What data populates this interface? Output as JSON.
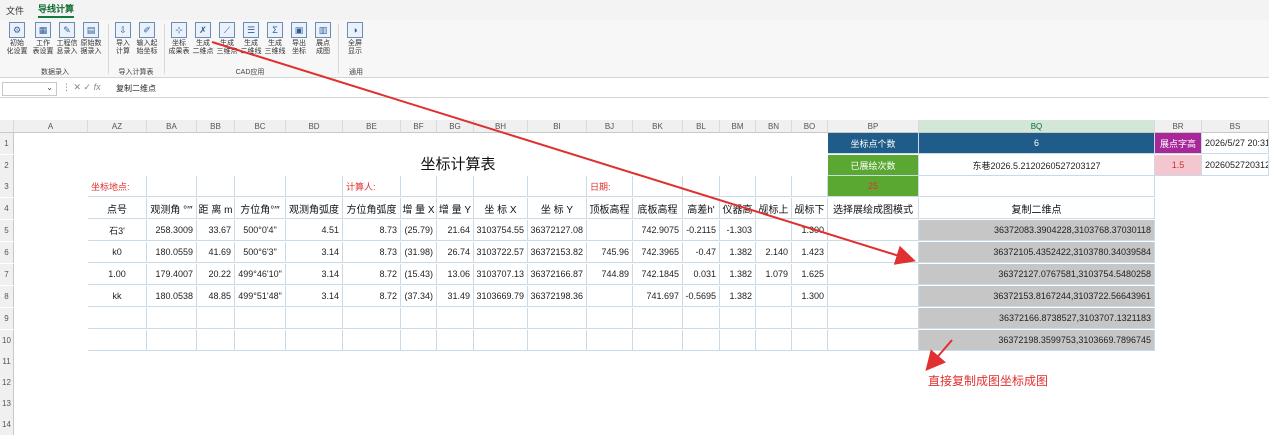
{
  "ribbon": {
    "tabs": [
      "文件",
      "导线计算"
    ],
    "active_tab": "导线计算",
    "buttons": [
      {
        "label": "初始化设置",
        "l1": "初始",
        "l2": "化设置",
        "icon": "settings-icon"
      },
      {
        "label": "工作表设置",
        "l1": "工作",
        "l2": "表设置",
        "icon": "table-icon"
      },
      {
        "label": "工程信息录入",
        "l1": "工程信",
        "l2": "息录入",
        "icon": "edit-icon"
      },
      {
        "label": "原始数据录入",
        "l1": "原始数",
        "l2": "据录入",
        "icon": "data-icon"
      },
      {
        "label": "导入计算",
        "l1": "导入",
        "l2": "计算",
        "icon": "import-icon"
      },
      {
        "label": "输入起始坐标",
        "l1": "输入起",
        "l2": "始坐标",
        "icon": "pen-icon"
      },
      {
        "label": "坐标成果表",
        "l1": "坐标",
        "l2": "成果表",
        "icon": "coord-icon"
      },
      {
        "label": "生成二维点",
        "l1": "生成",
        "l2": "二维点",
        "icon": "point2d-icon"
      },
      {
        "label": "生成三维点",
        "l1": "生成",
        "l2": "三维点",
        "icon": "point3d-icon"
      },
      {
        "label": "生成二维线",
        "l1": "生成",
        "l2": "二维线",
        "icon": "line2d-icon"
      },
      {
        "label": "生成三维线",
        "l1": "生成",
        "l2": "三维线",
        "icon": "sigma-icon"
      },
      {
        "label": "导出坐标",
        "l1": "导出",
        "l2": "坐标",
        "icon": "export-icon"
      },
      {
        "label": "展点成图",
        "l1": "展点",
        "l2": "成图",
        "icon": "plot-icon"
      },
      {
        "label": "全屏显示",
        "l1": "全屏",
        "l2": "显示",
        "icon": "toggle-icon"
      }
    ],
    "groups": [
      "数据录入",
      "导入计算表",
      "CAD应用",
      "通用"
    ]
  },
  "formula_bar": {
    "name_box": "",
    "formula": "复制二维点"
  },
  "columns": [
    "A",
    "AZ",
    "BA",
    "BB",
    "BC",
    "BD",
    "BE",
    "BF",
    "BG",
    "BH",
    "BI",
    "BJ",
    "BK",
    "BL",
    "BM",
    "BN",
    "BO",
    "BP",
    "BQ",
    "BR",
    "BS"
  ],
  "rows": [
    "1",
    "2",
    "3",
    "4",
    "5",
    "6",
    "7",
    "8",
    "9",
    "10",
    "11",
    "12",
    "13",
    "14"
  ],
  "sheet": {
    "title": "坐标计算表",
    "location_label": "坐标地点:",
    "calculator_label": "计算人:",
    "date_label": "日期:",
    "bp1": "坐标点个数",
    "bq1": "6",
    "br1": "展点字高",
    "bs1": "2026/5/27 20:31",
    "bp2": "已展绘次数",
    "bq2": "东巷2026.5.2120260527203127",
    "br2": "1.5",
    "bs2": "2026052720312",
    "bp3": "25",
    "headers": [
      "点号",
      "观测角 °′″",
      "距 离 m",
      "方位角°′″",
      "观测角弧度",
      "方位角弧度",
      "增 量 X",
      "增 量 Y",
      "坐 标 X",
      "坐 标 Y",
      "顶板高程",
      "底板高程",
      "高差h'",
      "仪器高",
      "觇标上",
      "觇标下",
      "选择展绘成图模式",
      "复制二维点"
    ],
    "data_rows": [
      [
        "石3'",
        "258.3009",
        "33.67",
        "500°0'4\"",
        "4.51",
        "8.73",
        "(25.79)",
        "21.64",
        "3103754.55",
        "36372127.08",
        "",
        "742.9075",
        "-0.2115",
        "-1.303",
        "",
        "1.300",
        "",
        "36372083.3904228,3103768.37030118"
      ],
      [
        "k0",
        "180.0559",
        "41.69",
        "500°6'3\"",
        "3.14",
        "8.73",
        "(31.98)",
        "26.74",
        "3103722.57",
        "36372153.82",
        "745.96",
        "742.3965",
        "-0.47",
        "1.382",
        "2.140",
        "1.423",
        "",
        "36372105.4352422,3103780.34039584"
      ],
      [
        "1.00",
        "179.4007",
        "20.22",
        "499°46'10\"",
        "3.14",
        "8.72",
        "(15.43)",
        "13.06",
        "3103707.13",
        "36372166.87",
        "744.89",
        "742.1845",
        "0.031",
        "1.382",
        "1.079",
        "1.625",
        "",
        "36372127.0767581,3103754.5480258"
      ],
      [
        "kk",
        "180.0538",
        "48.85",
        "499°51'48\"",
        "3.14",
        "8.72",
        "(37.34)",
        "31.49",
        "3103669.79",
        "36372198.36",
        "",
        "741.697",
        "-0.5695",
        "1.382",
        "",
        "1.300",
        "",
        "36372153.8167244,3103722.56643961"
      ],
      [
        "",
        "",
        "",
        "",
        "",
        "",
        "",
        "",
        "",
        "",
        "",
        "",
        "",
        "",
        "",
        "",
        "",
        "36372166.8738527,3103707.1321183"
      ],
      [
        "",
        "",
        "",
        "",
        "",
        "",
        "",
        "",
        "",
        "",
        "",
        "",
        "",
        "",
        "",
        "",
        "",
        "36372198.3599753,3103669.7896745"
      ]
    ]
  },
  "annotation": "直接复制成图坐标成图",
  "colors": {
    "accent_green": "#107c41",
    "header_blue": "#1f5c8a",
    "header_green": "#5aa832",
    "header_purple": "#a8289a",
    "light_pink": "#f4c6cf",
    "gray_fill": "#c6c6c6",
    "arrow_red": "#e03030"
  }
}
